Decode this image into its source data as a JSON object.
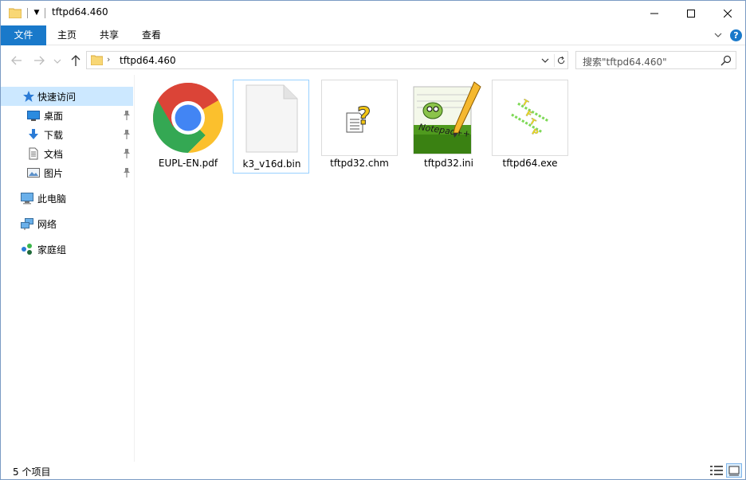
{
  "window": {
    "title": "tftpd64.460"
  },
  "ribbon": {
    "tabs": [
      {
        "label": "文件"
      },
      {
        "label": "主页"
      },
      {
        "label": "共享"
      },
      {
        "label": "查看"
      }
    ]
  },
  "address": {
    "path": "tftpd64.460"
  },
  "search": {
    "placeholder": "搜索\"tftpd64.460\""
  },
  "sidebar": {
    "items": [
      {
        "label": "快速访问",
        "icon": "star-icon"
      },
      {
        "label": "桌面",
        "icon": "desktop-icon"
      },
      {
        "label": "下载",
        "icon": "download-icon"
      },
      {
        "label": "文档",
        "icon": "document-icon"
      },
      {
        "label": "图片",
        "icon": "pictures-icon"
      },
      {
        "label": "此电脑",
        "icon": "computer-icon"
      },
      {
        "label": "网络",
        "icon": "network-icon"
      },
      {
        "label": "家庭组",
        "icon": "homegroup-icon"
      }
    ]
  },
  "files": [
    {
      "name": "EUPL-EN.pdf",
      "icon": "chrome-icon"
    },
    {
      "name": "k3_v16d.bin",
      "icon": "blank-file-icon"
    },
    {
      "name": "tftpd32.chm",
      "icon": "help-file-icon"
    },
    {
      "name": "tftpd32.ini",
      "icon": "notepadpp-icon"
    },
    {
      "name": "tftpd64.exe",
      "icon": "tftp-app-icon"
    }
  ],
  "status": {
    "item_count": "5 个项目"
  },
  "colors": {
    "accent": "#1979ca",
    "selection": "#cce8ff",
    "selection_border": "#99d1ff"
  }
}
